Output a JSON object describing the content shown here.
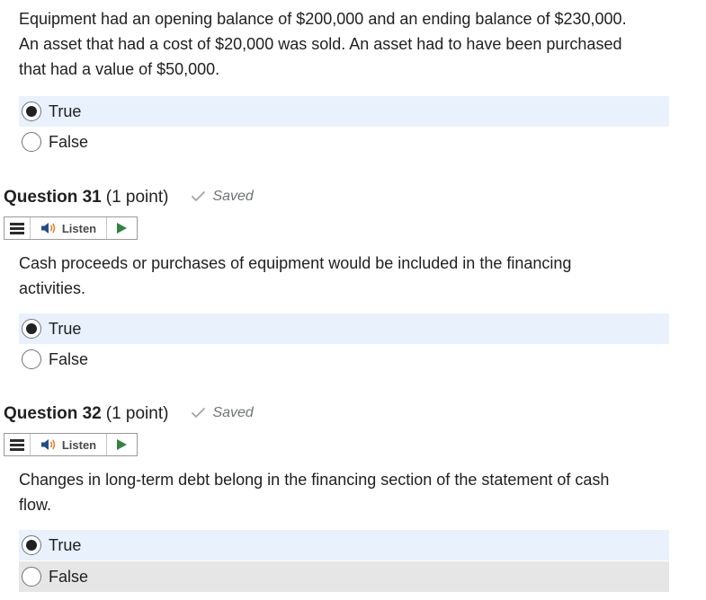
{
  "q30": {
    "text_line1": "Equipment had an opening balance of $200,000 and an ending balance of $230,000.",
    "text_line2": "An asset that had a cost of $20,000 was sold.  An asset had to have been purchased",
    "text_line3": "that had a value of $50,000.",
    "options": [
      {
        "label": "True",
        "selected": true
      },
      {
        "label": "False",
        "selected": false
      }
    ]
  },
  "q31": {
    "title": "Question 31",
    "points": "(1 point)",
    "status": "Saved",
    "listen_label": "Listen",
    "text_line1": "Cash proceeds or purchases of equipment would be included in the financing",
    "text_line2": "activities.",
    "options": [
      {
        "label": "True",
        "selected": true
      },
      {
        "label": "False",
        "selected": false
      }
    ]
  },
  "q32": {
    "title": "Question 32",
    "points": "(1 point)",
    "status": "Saved",
    "listen_label": "Listen",
    "text_line1": "Changes in long-term debt belong in the financing section of the statement of cash",
    "text_line2": "flow.",
    "options": [
      {
        "label": "True",
        "selected": true
      },
      {
        "label": "False",
        "selected": false,
        "hovered": true
      }
    ]
  },
  "colors": {
    "selected_bg": "#e8f1fc",
    "hover_bg": "#e6e6e6",
    "text": "#202122",
    "muted": "#6e7376",
    "play_green": "#2e8540",
    "speaker_blue": "#1f4e8c"
  }
}
